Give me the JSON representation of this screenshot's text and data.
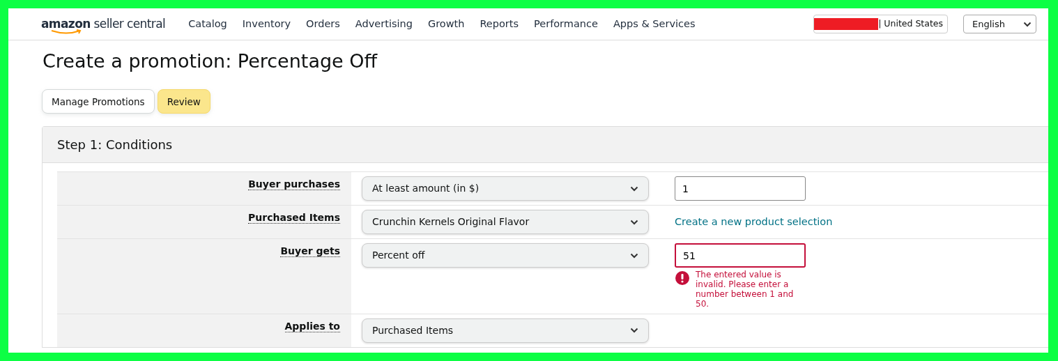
{
  "header": {
    "logo": "**amazon** seller central",
    "nav": [
      {
        "label": "Catalog"
      },
      {
        "label": "Inventory"
      },
      {
        "label": "Orders"
      },
      {
        "label": "Advertising"
      },
      {
        "label": "Growth"
      },
      {
        "label": "Reports"
      },
      {
        "label": "Performance"
      },
      {
        "label": "Apps & Services"
      }
    ],
    "account": {
      "marketplace": "| United States",
      "redacted": true
    },
    "language": "English"
  },
  "page_title": "Create a promotion: Percentage Off",
  "buttons": [
    {
      "label": "Manage Promotions",
      "kind": "default"
    },
    {
      "label": "Review",
      "kind": "primary"
    }
  ],
  "step": {
    "title": "Step 1: Conditions",
    "rows": [
      {
        "label": "Buyer purchases",
        "select": "At least amount (in $)",
        "extra": {
          "kind": "input",
          "value": "1",
          "invalid": false
        }
      },
      {
        "label": "Purchased Items",
        "select": "Crunchin Kernels Original Flavor",
        "extra": {
          "kind": "link",
          "text": "Create a new product selection"
        }
      },
      {
        "label": "Buyer gets",
        "select": "Percent off",
        "extra": {
          "kind": "input",
          "value": "51",
          "invalid": true,
          "error": "The entered value is invalid. Please enter a number between 1 and 50."
        }
      },
      {
        "label": "Applies to",
        "select": "Purchased Items"
      }
    ]
  }
}
